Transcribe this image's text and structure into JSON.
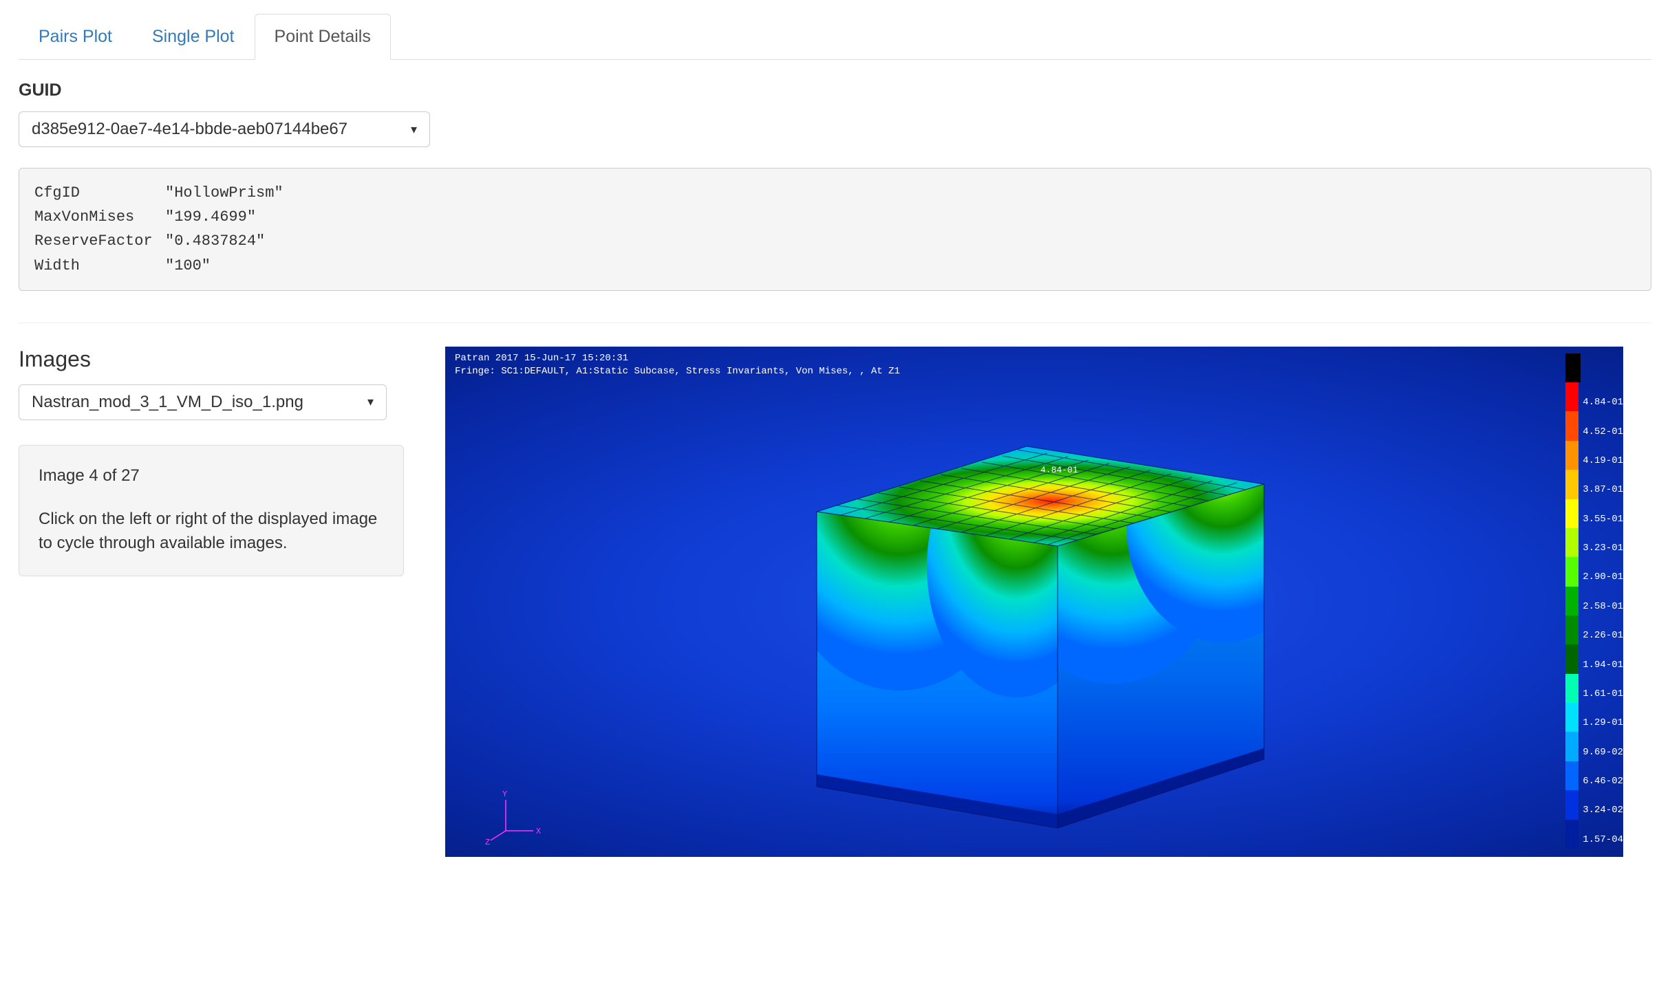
{
  "tabs": [
    {
      "label": "Pairs Plot",
      "active": false
    },
    {
      "label": "Single Plot",
      "active": false
    },
    {
      "label": "Point Details",
      "active": true
    }
  ],
  "guid": {
    "label": "GUID",
    "selected": "d385e912-0ae7-4e14-bbde-aeb07144be67"
  },
  "details": {
    "rows": [
      {
        "key": "CfgID",
        "value": "\"HollowPrism\""
      },
      {
        "key": "MaxVonMises",
        "value": "\"199.4699\""
      },
      {
        "key": "ReserveFactor",
        "value": "\"0.4837824\""
      },
      {
        "key": "Width",
        "value": "\"100\""
      }
    ]
  },
  "images": {
    "heading": "Images",
    "selected": "Nastran_mod_3_1_VM_D_iso_1.png",
    "counter": "Image 4 of 27",
    "hint": "Click on the left or right of the displayed image to cycle through available images."
  },
  "render": {
    "header_line1": "Patran 2017 15-Jun-17 15:20:31",
    "header_line2": "Fringe: SC1:DEFAULT, A1:Static Subcase, Stress Invariants, Von Mises, , At Z1",
    "peak_label": "4.84-01",
    "axis": {
      "x": "X",
      "y": "Y",
      "z": "Z"
    },
    "colorbar": [
      {
        "color": "#000000",
        "label": ""
      },
      {
        "color": "#ff0000",
        "label": "4.84-01"
      },
      {
        "color": "#ff4a00",
        "label": "4.52-01"
      },
      {
        "color": "#ff9200",
        "label": "4.19-01"
      },
      {
        "color": "#ffc800",
        "label": "3.87-01"
      },
      {
        "color": "#ffff00",
        "label": "3.55-01"
      },
      {
        "color": "#b2ff00",
        "label": "3.23-01"
      },
      {
        "color": "#55ff00",
        "label": "2.90-01"
      },
      {
        "color": "#00b200",
        "label": "2.58-01"
      },
      {
        "color": "#008c00",
        "label": "2.26-01"
      },
      {
        "color": "#006600",
        "label": "1.94-01"
      },
      {
        "color": "#00ffb0",
        "label": "1.61-01"
      },
      {
        "color": "#00e0ff",
        "label": "1.29-01"
      },
      {
        "color": "#00aaff",
        "label": "9.69-02"
      },
      {
        "color": "#0066ff",
        "label": "6.46-02"
      },
      {
        "color": "#0030e0",
        "label": "3.24-02"
      },
      {
        "color": "#001ea0",
        "label": "1.57-04"
      }
    ]
  }
}
